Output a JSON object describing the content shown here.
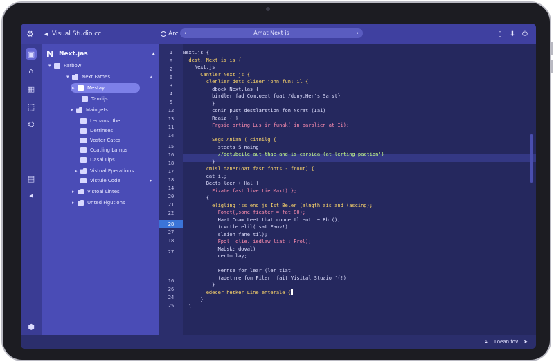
{
  "topbar": {
    "back_label": "Visual Studio cc",
    "run_label": "Arc",
    "search_text": "Amat Next js"
  },
  "sidebar": {
    "header": "Next.jas",
    "tree": [
      {
        "label": "Parbow",
        "icon": "folder-icon",
        "twisty": "▾"
      },
      {
        "label": "Next Fames",
        "icon": "folder-icon",
        "twisty": "▾",
        "chevron": "▴"
      },
      {
        "label": "Mestay",
        "icon": "file-icon",
        "twisty": "▸",
        "selected": true
      },
      {
        "label": "Tamlijs",
        "icon": "file-icon",
        "twisty": ""
      },
      {
        "label": "Maingets",
        "icon": "folder-icon",
        "twisty": "▾"
      },
      {
        "label": "Lemans Ube",
        "icon": "file-icon",
        "twisty": ""
      },
      {
        "label": "Dettinses",
        "icon": "file-icon",
        "twisty": ""
      },
      {
        "label": "Voster Cates",
        "icon": "file-icon",
        "twisty": ""
      },
      {
        "label": "Coatling Lamps",
        "icon": "file-icon",
        "twisty": ""
      },
      {
        "label": "Dasal Lips",
        "icon": "file-icon",
        "twisty": ""
      },
      {
        "label": "Vistual Eperations",
        "icon": "folder-icon",
        "twisty": "▸"
      },
      {
        "label": "Vistuie Code",
        "icon": "file-icon",
        "twisty": "",
        "chevron": "▸"
      },
      {
        "label": "Vistoal Lintes",
        "icon": "folder-icon",
        "twisty": "▸",
        "chevron": "▴"
      },
      {
        "label": "Unted Figutions",
        "icon": "folder-icon",
        "twisty": "▸"
      }
    ]
  },
  "editor": {
    "line_numbers": [
      "1",
      "0",
      "2",
      "6",
      "3",
      "4",
      "5",
      "12",
      "13",
      "11",
      "14",
      "15",
      "16",
      "18",
      "17",
      "18",
      "14",
      "20",
      "21",
      "22",
      "28",
      "27",
      "18",
      "27",
      "",
      "16",
      "26",
      "24",
      "25"
    ],
    "active_line_index": 20,
    "code": [
      "Next.js {",
      "  dest. Next is is {",
      "    Next.js",
      "      Cantler Next js {",
      "        clenlier dets clieer jonn fun: il {",
      "          dbock Next.las {",
      "          birdler fad Com.oeat fuat /ddny.Her's Sarst}",
      "          }",
      "          conir pust destlarstion fon Ncrat (Iai)",
      "          Reaiz { }",
      "          Frgsie brting Lus ir funak( in parplien at Ii);",
      "",
      "          Segs Anian ( citnilg {",
      "            steats $ naing",
      "            //dotubeile aut thae and is carsiea (at lerting paction'}",
      "          }",
      "        cmisl daner(oat fast fonts - frout) {",
      "        eat il;",
      "        Beets laer ( Hal )",
      "          Fizate fast live tie Maxt) };",
      "        {",
      "          eligling jss end js Ist Beler (alngth ais and (ascing);",
      "            Fomet(,sone fiester = fat 80);",
      "            Haat Coam Leet that connettltent  ~ 8b ();",
      "            (cvotle elil( sat Faov!)",
      "            sleion fane til);",
      "            Fpol: clie. iedlaw liat : Frol);",
      "            Mabsk: doval)",
      "            certm lay;",
      "",
      "            Fernse for lear (ler tiat",
      "            (adethre fon Piler  fait Visital Stuaio '(!)",
      "          }",
      "        edecer hetker Line enterale {",
      "      }",
      "  }"
    ]
  },
  "status": {
    "right_text": "Loean fov|"
  },
  "colors": {
    "topbar": "#3f40a0",
    "sidebar": "#4a4cb6",
    "editor_bg": "#25285e",
    "active_line_number": "#3b74d8",
    "keyword": "#ffd86b",
    "string": "#ff8fb0"
  }
}
